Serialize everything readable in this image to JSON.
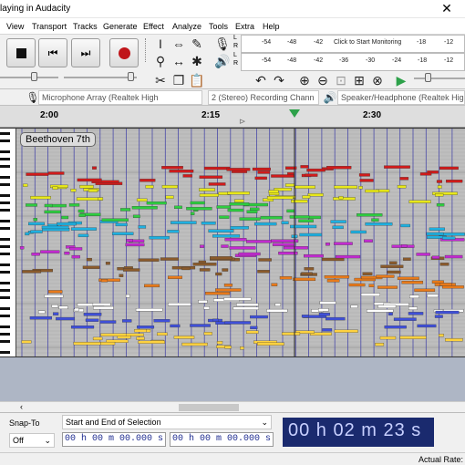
{
  "window": {
    "title": "laying in Audacity"
  },
  "menu": [
    "View",
    "Transport",
    "Tracks",
    "Generate",
    "Effect",
    "Analyze",
    "Tools",
    "Extra",
    "Help"
  ],
  "meters": {
    "record_ticks": [
      "-54",
      "-48",
      "-42",
      "Click to Start Monitoring",
      "-18",
      "-12"
    ],
    "play_ticks": [
      "-54",
      "-48",
      "-42",
      "-36",
      "-30",
      "-24",
      "-18",
      "-12"
    ],
    "lr": [
      "L",
      "R"
    ]
  },
  "devices": {
    "input": "Microphone Array (Realtek High",
    "channels": "2 (Stereo) Recording Chann",
    "output": "Speaker/Headphone (Realtek High"
  },
  "ruler": {
    "labels": [
      "2:00",
      "2:15",
      "2:30"
    ]
  },
  "track": {
    "name": "Beethoven 7th"
  },
  "colors": {
    "grid_bg": "#b9b9b9",
    "time_bg": "#1a2a6e",
    "empty_bg": "#aeb6c5"
  },
  "bottom": {
    "snap_label": "Snap-To",
    "snap_value": "Off",
    "selection_mode": "Start and End of Selection",
    "sel_start": "00 h 00 m 00.000 s",
    "sel_end": "00 h 00 m 00.000 s",
    "big_time": "00 h 02 m 23 s",
    "status_right": "Actual Rate:"
  },
  "icons": {
    "stop": "stop-icon",
    "skip_start": "skip-start-icon",
    "skip_end": "skip-end-icon",
    "record": "record-icon",
    "selection": "selection-tool-icon",
    "envelope": "envelope-tool-icon",
    "draw": "draw-tool-icon",
    "zoom": "zoom-tool-icon",
    "timeshift": "time-shift-icon",
    "multi": "multi-tool-icon",
    "cut": "cut-icon",
    "copy": "copy-icon",
    "paste": "paste-icon",
    "mic": "microphone-icon",
    "speaker": "speaker-icon",
    "undo": "undo-icon",
    "redo": "redo-icon",
    "zoom_in": "zoom-in-icon",
    "zoom_out": "zoom-out-icon",
    "fit_sel": "fit-selection-icon",
    "fit_proj": "fit-project-icon",
    "zoom_toggle": "zoom-toggle-icon",
    "play_at_speed": "play-at-speed-icon"
  }
}
